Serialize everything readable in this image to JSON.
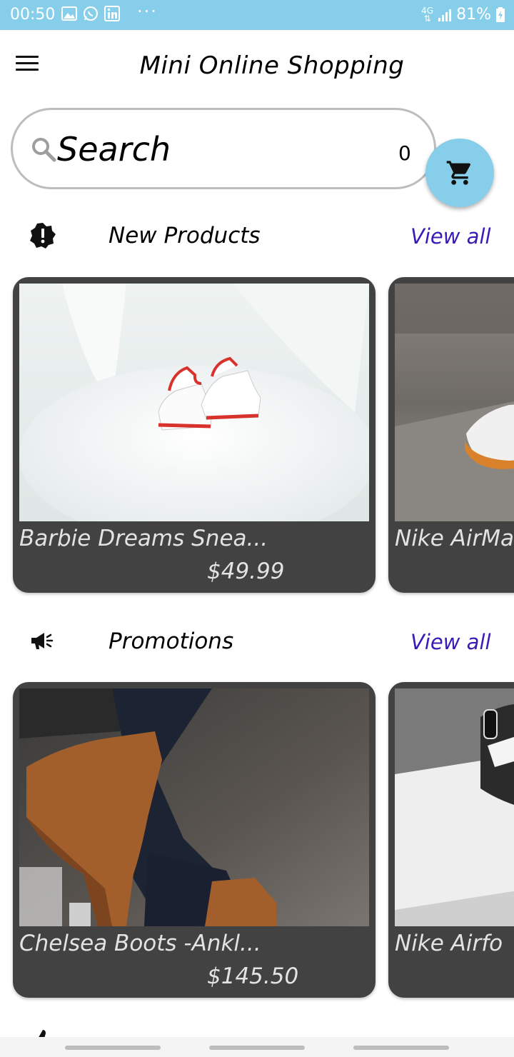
{
  "status_bar": {
    "time": "00:50",
    "battery": "81%",
    "network": "4G",
    "more": "···"
  },
  "app_bar": {
    "title": "Mini Online Shopping"
  },
  "search": {
    "label": "Search",
    "cart_count": "0"
  },
  "sections": [
    {
      "title": "New Products",
      "view_all": "View all",
      "icon": "alert-badge-icon",
      "products": [
        {
          "name": "Barbie Dreams Snea...",
          "price": "$49.99"
        },
        {
          "name": "Nike AirMa",
          "price": ""
        }
      ]
    },
    {
      "title": "Promotions",
      "view_all": "View all",
      "icon": "megaphone-icon",
      "products": [
        {
          "name": "Chelsea Boots -Ankl...",
          "price": "$145.50"
        },
        {
          "name": "Nike Airfo",
          "price": ""
        }
      ]
    }
  ],
  "colors": {
    "accent": "#87CEEB",
    "link": "#3a1bb5",
    "card": "#424242"
  }
}
